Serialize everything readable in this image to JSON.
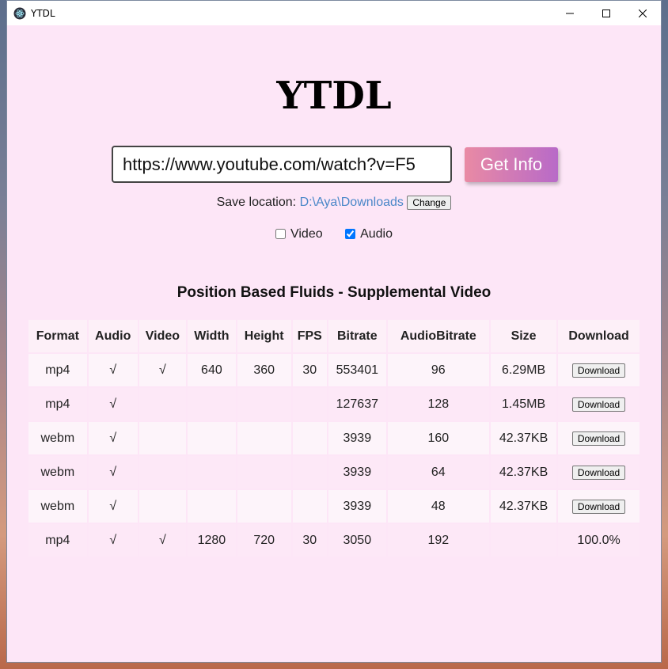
{
  "window": {
    "title": "YTDL",
    "bg_color": "#fde6f7"
  },
  "header": {
    "title": "YTDL"
  },
  "url_input": {
    "value": "https://www.youtube.com/watch?v=F5"
  },
  "get_info_label": "Get Info",
  "save": {
    "label": "Save location:",
    "path": "D:\\Aya\\Downloads",
    "change_label": "Change"
  },
  "checks": {
    "video_label": "Video",
    "video_checked": false,
    "audio_label": "Audio",
    "audio_checked": true
  },
  "video_title": "Position Based Fluids - Supplemental Video",
  "table": {
    "headers": [
      "Format",
      "Audio",
      "Video",
      "Width",
      "Height",
      "FPS",
      "Bitrate",
      "AudioBitrate",
      "Size",
      "Download"
    ],
    "rows": [
      {
        "format": "mp4",
        "audio": "√",
        "video": "√",
        "width": "640",
        "height": "360",
        "fps": "30",
        "bitrate": "553401",
        "audio_bitrate": "96",
        "size": "6.29MB",
        "download": "Download"
      },
      {
        "format": "mp4",
        "audio": "√",
        "video": "",
        "width": "",
        "height": "",
        "fps": "",
        "bitrate": "127637",
        "audio_bitrate": "128",
        "size": "1.45MB",
        "download": "Download"
      },
      {
        "format": "webm",
        "audio": "√",
        "video": "",
        "width": "",
        "height": "",
        "fps": "",
        "bitrate": "3939",
        "audio_bitrate": "160",
        "size": "42.37KB",
        "download": "Download"
      },
      {
        "format": "webm",
        "audio": "√",
        "video": "",
        "width": "",
        "height": "",
        "fps": "",
        "bitrate": "3939",
        "audio_bitrate": "64",
        "size": "42.37KB",
        "download": "Download"
      },
      {
        "format": "webm",
        "audio": "√",
        "video": "",
        "width": "",
        "height": "",
        "fps": "",
        "bitrate": "3939",
        "audio_bitrate": "48",
        "size": "42.37KB",
        "download": "Download"
      },
      {
        "format": "mp4",
        "audio": "√",
        "video": "√",
        "width": "1280",
        "height": "720",
        "fps": "30",
        "bitrate": "3050",
        "audio_bitrate": "192",
        "size": "",
        "download": "100.0%"
      }
    ]
  }
}
